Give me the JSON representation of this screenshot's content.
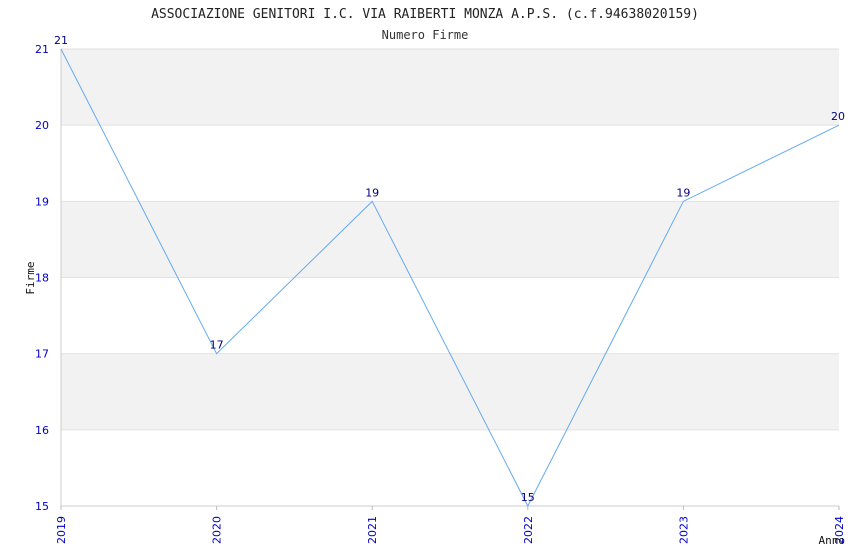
{
  "chart_data": {
    "type": "line",
    "title": "ASSOCIAZIONE GENITORI I.C. VIA RAIBERTI MONZA A.P.S. (c.f.94638020159)",
    "subtitle": "Numero Firme",
    "xlabel": "Anno",
    "ylabel": "Firme",
    "categories": [
      "2019",
      "2020",
      "2021",
      "2022",
      "2023",
      "2024"
    ],
    "values": [
      21,
      17,
      19,
      15,
      19,
      20
    ],
    "data_labels": [
      "21",
      "17",
      "19",
      "15",
      "19",
      "20"
    ],
    "yticks": [
      "15",
      "16",
      "17",
      "18",
      "19",
      "20",
      "21"
    ],
    "ylim": [
      15,
      21
    ],
    "grid": true,
    "band_color": "#f2f2f2",
    "line_color": "#66aaee",
    "tick_color": "#0000cc",
    "label_color": "#000080"
  }
}
